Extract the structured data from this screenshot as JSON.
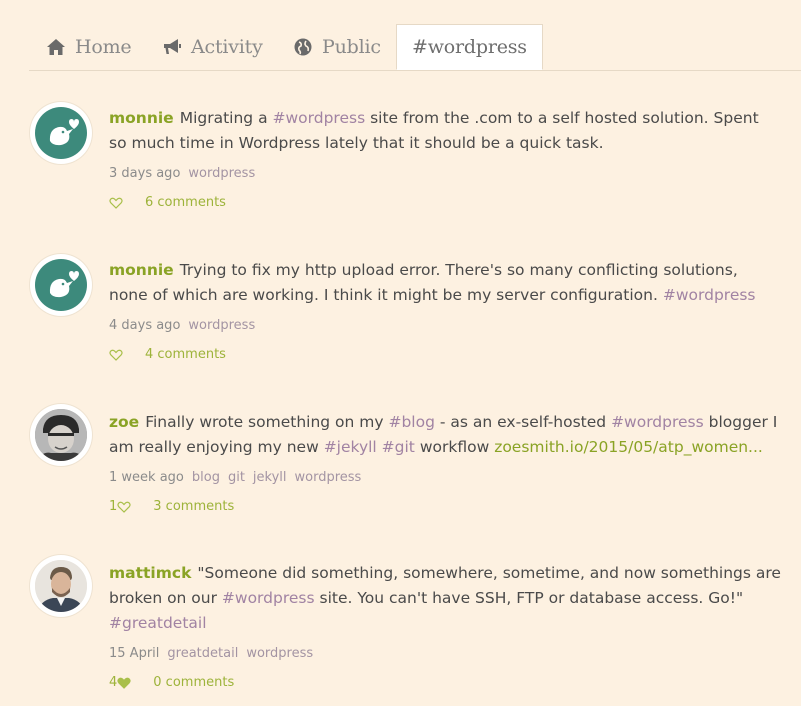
{
  "tabs": [
    {
      "label": "Home",
      "icon": "home-icon"
    },
    {
      "label": "Activity",
      "icon": "megaphone-icon"
    },
    {
      "label": "Public",
      "icon": "globe-icon"
    },
    {
      "label": "#wordpress",
      "icon": ""
    }
  ],
  "posts": [
    {
      "user": "monnie",
      "segments": [
        "Migrating a ",
        "#wordpress",
        " site from the .com to a self hosted solution. Spent so much time in Wordpress lately that it should be a quick task."
      ],
      "time": "3 days ago",
      "tags": [
        "wordpress"
      ],
      "likes": "",
      "comments": "6 comments"
    },
    {
      "user": "monnie",
      "segments": [
        "Trying to fix my http upload error. There's so many conflicting solutions, none of which are working. I think it might be my server configuration. ",
        "#wordpress"
      ],
      "time": "4 days ago",
      "tags": [
        "wordpress"
      ],
      "likes": "",
      "comments": "4 comments"
    },
    {
      "user": "zoe",
      "segments": [
        "Finally wrote something on my ",
        "#blog",
        " - as an ex-self-hosted ",
        "#wordpress",
        " blogger I am really enjoying my new ",
        "#jekyll",
        " ",
        "#git",
        " workflow ",
        "zoesmith.io/2015/05/atp_women..."
      ],
      "time": "1 week ago",
      "tags": [
        "blog",
        "git",
        "jekyll",
        "wordpress"
      ],
      "likes": "1",
      "comments": "3 comments"
    },
    {
      "user": "mattimck",
      "segments": [
        "\"Someone did something, somewhere, sometime, and now somethings are broken on our ",
        "#wordpress",
        " site. You can't have SSH, FTP or database access. Go!\" ",
        "#greatdetail"
      ],
      "time": "15 April",
      "tags": [
        "greatdetail",
        "wordpress"
      ],
      "likes": "4",
      "comments": "0 comments"
    }
  ],
  "colors": {
    "background": "#fdf1e1",
    "username": "#8aa325",
    "hashtag": "#a183a3",
    "avatar_teal": "#3d8a7c"
  }
}
